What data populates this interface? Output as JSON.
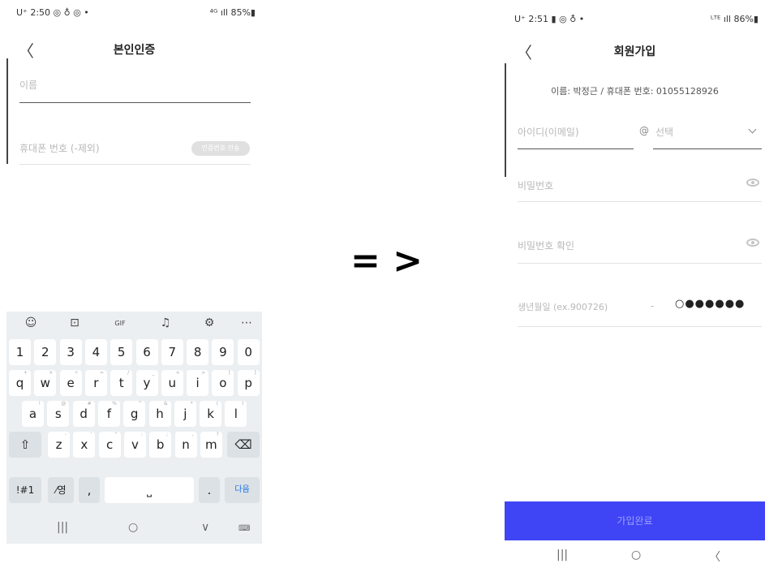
{
  "left": {
    "status": {
      "time": "U⁺ 2:50 ◎ ♁ ◎ •",
      "right": "⁴ᴳ ıll 85%▮"
    },
    "nav": {
      "back": "〈",
      "title": "본인인증"
    },
    "fields": {
      "name_placeholder": "이름",
      "phone_placeholder": "휴대폰 번호 (-제외)",
      "send_code_button": "인증번호 전송"
    }
  },
  "keyboard": {
    "toolbar": [
      "☺",
      "⊡",
      "GIF",
      "♫",
      "⚙",
      "⋯"
    ],
    "numbers": [
      "1",
      "2",
      "3",
      "4",
      "5",
      "6",
      "7",
      "8",
      "9",
      "0"
    ],
    "row1": [
      {
        "k": "q",
        "h": "+"
      },
      {
        "k": "w",
        "h": "×"
      },
      {
        "k": "e",
        "h": "÷"
      },
      {
        "k": "r",
        "h": "="
      },
      {
        "k": "t",
        "h": "/"
      },
      {
        "k": "y",
        "h": "_"
      },
      {
        "k": "u",
        "h": "<"
      },
      {
        "k": "i",
        "h": ">"
      },
      {
        "k": "o",
        "h": "["
      },
      {
        "k": "p",
        "h": "]"
      }
    ],
    "row2": [
      {
        "k": "a",
        "h": "!"
      },
      {
        "k": "s",
        "h": "@"
      },
      {
        "k": "d",
        "h": "#"
      },
      {
        "k": "f",
        "h": "%"
      },
      {
        "k": "g",
        "h": "^"
      },
      {
        "k": "h",
        "h": "&"
      },
      {
        "k": "j",
        "h": "*"
      },
      {
        "k": "k",
        "h": "("
      },
      {
        "k": "l",
        "h": ")"
      }
    ],
    "row3": [
      {
        "k": "z",
        "h": "-"
      },
      {
        "k": "x",
        "h": "'"
      },
      {
        "k": "c",
        "h": "\""
      },
      {
        "k": "v",
        "h": ":"
      },
      {
        "k": "b",
        "h": ";"
      },
      {
        "k": "n",
        "h": ","
      },
      {
        "k": "m",
        "h": "?"
      }
    ],
    "shift": "⇧",
    "backspace": "⌫",
    "sym": "!#1",
    "lang": "⁄영",
    "comma": ",",
    "space": "⎵",
    "period": ".",
    "next": "다음",
    "nav": {
      "recent": "|||",
      "home": "○",
      "back": "∨",
      "kbd": "⌨"
    }
  },
  "arrow": "= >",
  "right": {
    "status": {
      "time": "U⁺ 2:51 ▮ ◎ ♁ •",
      "right": "ᴸᵀᴱ ıll 86%▮"
    },
    "nav": {
      "back": "〈",
      "title": "회원가입"
    },
    "info": "이름: 박정근 / 휴대폰 번호: 01055128926",
    "fields": {
      "id_placeholder": "아이디(이메일)",
      "at": "@",
      "domain_placeholder": "선택",
      "password_placeholder": "비밀번호",
      "password_confirm_placeholder": "비밀번호 확인",
      "birth_placeholder": "생년월일 (ex.900726)",
      "birth_dash": "-",
      "gender_dots": "○●●●●●●"
    },
    "submit": "가입완료",
    "sys_nav": {
      "recent": "|||",
      "home": "○",
      "back": "〈"
    }
  }
}
